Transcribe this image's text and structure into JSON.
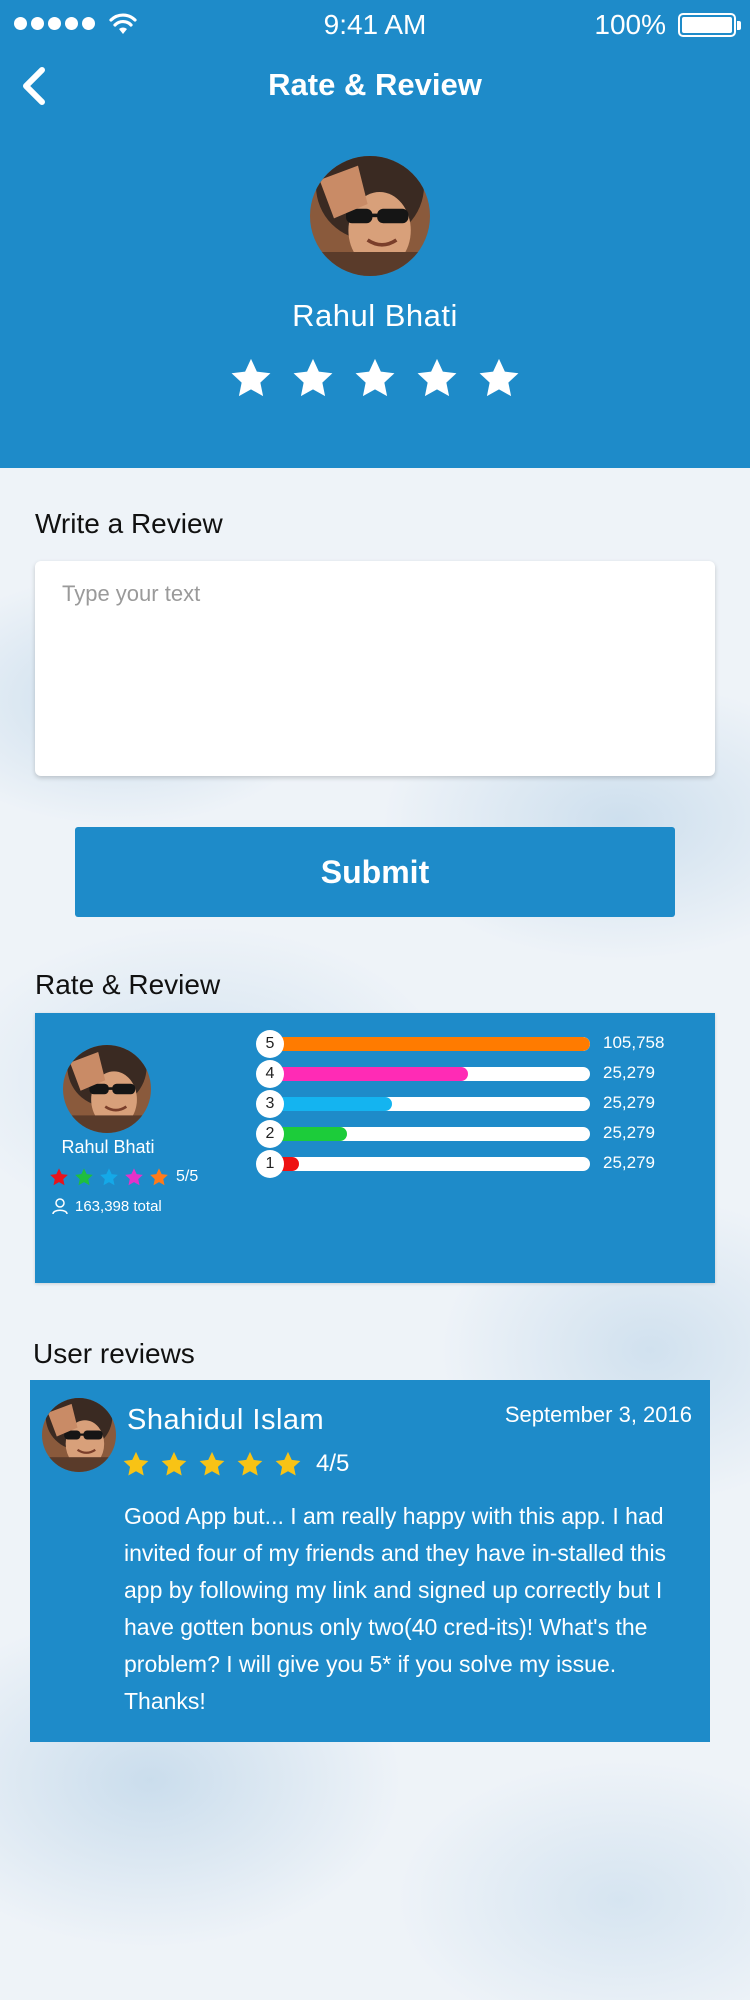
{
  "status_bar": {
    "time": "9:41 AM",
    "battery": "100%"
  },
  "nav": {
    "title": "Rate & Review",
    "back_icon": "chevron-left-icon"
  },
  "profile": {
    "name": "Rahul Bhati",
    "stars_selected": 5,
    "star_color": "#ffffff"
  },
  "write_review": {
    "title": "Write a Review",
    "placeholder": "Type your text",
    "value": "",
    "submit_label": "Submit"
  },
  "summary": {
    "title": "Rate & Review",
    "name": "Rahul Bhati",
    "score": "5/5",
    "total": "163,398 total",
    "star_colors": [
      "#e8141c",
      "#1fbf3f",
      "#14a9e8",
      "#e532c8",
      "#ff7b1a"
    ],
    "bars": [
      {
        "label": "5",
        "count": "105,758",
        "fraction": 1.0,
        "color": "#ff7b00"
      },
      {
        "label": "4",
        "count": "25,279",
        "fraction": 0.62,
        "color": "#ff2bb5"
      },
      {
        "label": "3",
        "count": "25,279",
        "fraction": 0.38,
        "color": "#14b4f0"
      },
      {
        "label": "2",
        "count": "25,279",
        "fraction": 0.24,
        "color": "#1ccc3a"
      },
      {
        "label": "1",
        "count": "25,279",
        "fraction": 0.09,
        "color": "#ee1111"
      }
    ]
  },
  "user_reviews": {
    "title": "User reviews",
    "items": [
      {
        "name": "Shahidul Islam",
        "date": "September 3, 2016",
        "stars": 5,
        "star_color": "#f8c315",
        "score": "4/5",
        "text": "Good App but... I am really happy with this app. I had invited four of my friends and they have in-stalled this app by following my link and signed up correctly but I have gotten bonus only two(40 cred-its)! What's the problem? I will give you 5* if you solve my issue. Thanks!"
      }
    ]
  },
  "colors": {
    "primary": "#1e8bc9",
    "page_background": "#eef3f8"
  }
}
